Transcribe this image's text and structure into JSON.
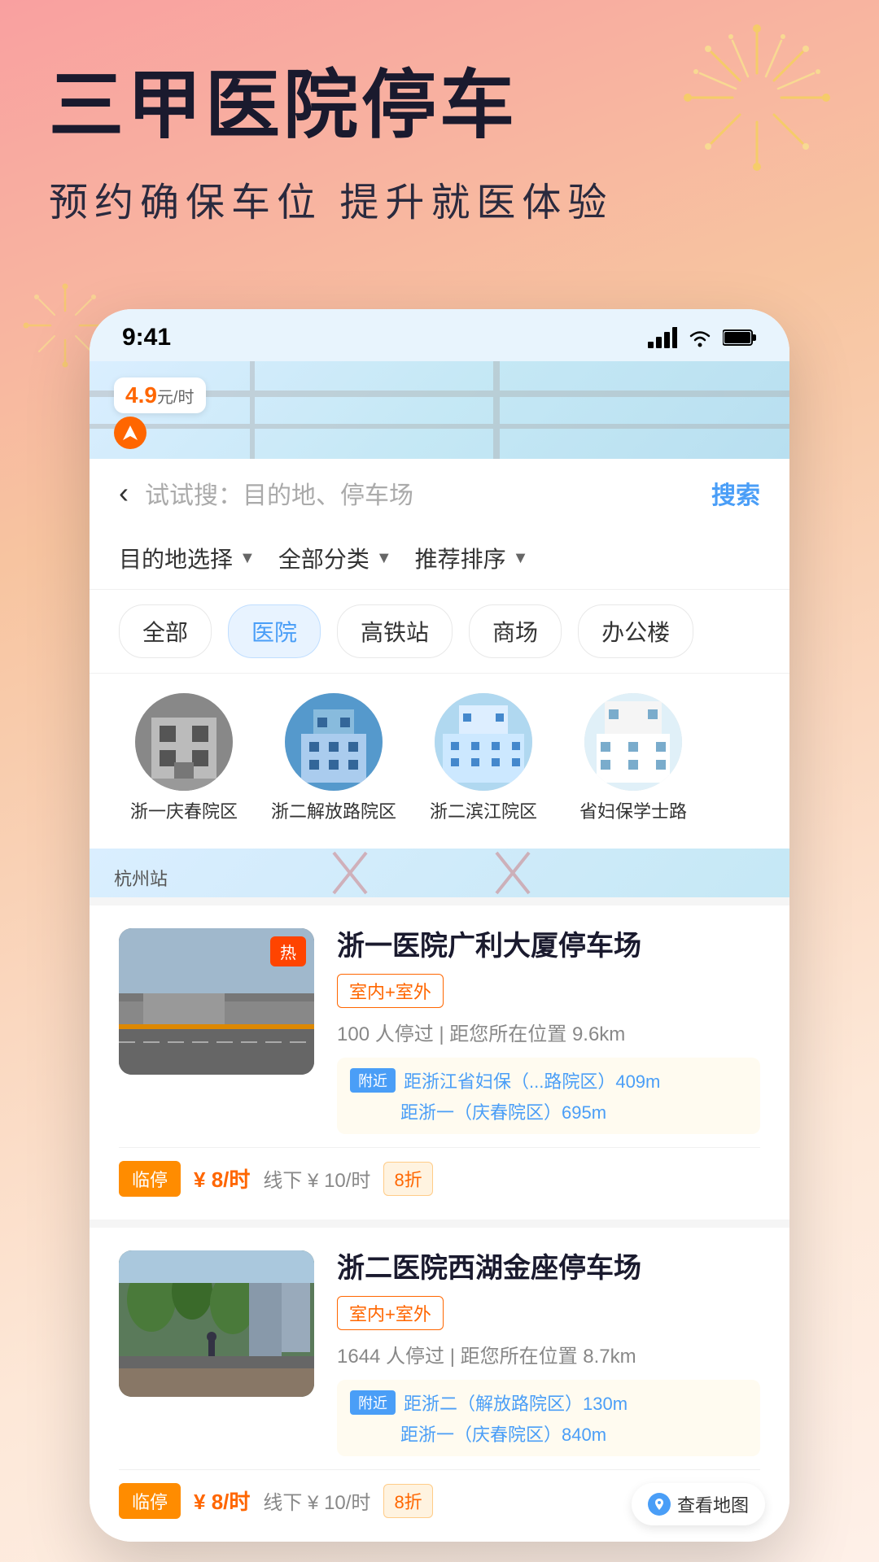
{
  "hero": {
    "title": "三甲医院停车",
    "subtitle": "预约确保车位   提升就医体验"
  },
  "status_bar": {
    "time": "9:41",
    "signal": "signal",
    "wifi": "wifi",
    "battery": "battery"
  },
  "search": {
    "placeholder": "试试搜：目的地、停车场",
    "button": "搜索",
    "back": "‹"
  },
  "filters": [
    {
      "label": "目的地选择",
      "arrow": "▼"
    },
    {
      "label": "全部分类",
      "arrow": "▼"
    },
    {
      "label": "推荐排序",
      "arrow": "▼"
    }
  ],
  "categories": [
    {
      "label": "全部",
      "active": false
    },
    {
      "label": "医院",
      "active": true
    },
    {
      "label": "高铁站",
      "active": false
    },
    {
      "label": "商场",
      "active": false
    },
    {
      "label": "办公楼",
      "active": false
    }
  ],
  "hospitals": [
    {
      "name": "浙一庆春院区",
      "color": "#888"
    },
    {
      "name": "浙二解放路院区",
      "color": "#5599cc"
    },
    {
      "name": "浙二滨江院区",
      "color": "#44aacc"
    },
    {
      "name": "省妇保学士路",
      "color": "#77aacc"
    }
  ],
  "parking_lots": [
    {
      "title": "浙一医院广利大厦停车场",
      "tag": "室内+室外",
      "stats": "100 人停过 | 距您所在位置 9.6km",
      "nearby": [
        {
          "label": "附近",
          "text1": "距浙江省妇保（...路院区）409m"
        },
        {
          "label": "",
          "text2": "距浙一（庆春院区）695m"
        }
      ],
      "temp_label": "临停",
      "price": "¥ 8/时",
      "offline": "线下 ¥ 10/时",
      "discount": "8折"
    },
    {
      "title": "浙二医院西湖金座停车场",
      "tag": "室内+室外",
      "stats": "1644 人停过 | 距您所在位置 8.7km",
      "nearby": [
        {
          "label": "附近",
          "text1": "距浙二（解放路院区）130m"
        },
        {
          "label": "",
          "text2": "距浙一（庆春院区）840m"
        }
      ],
      "temp_label": "临停",
      "price": "¥ 8/时",
      "offline": "线下 ¥ 10/时",
      "discount": "8折"
    }
  ],
  "map_view_btn": "查看地图",
  "map_price": {
    "value": "4.9",
    "unit": "元/时"
  },
  "map_label": "杭州站"
}
